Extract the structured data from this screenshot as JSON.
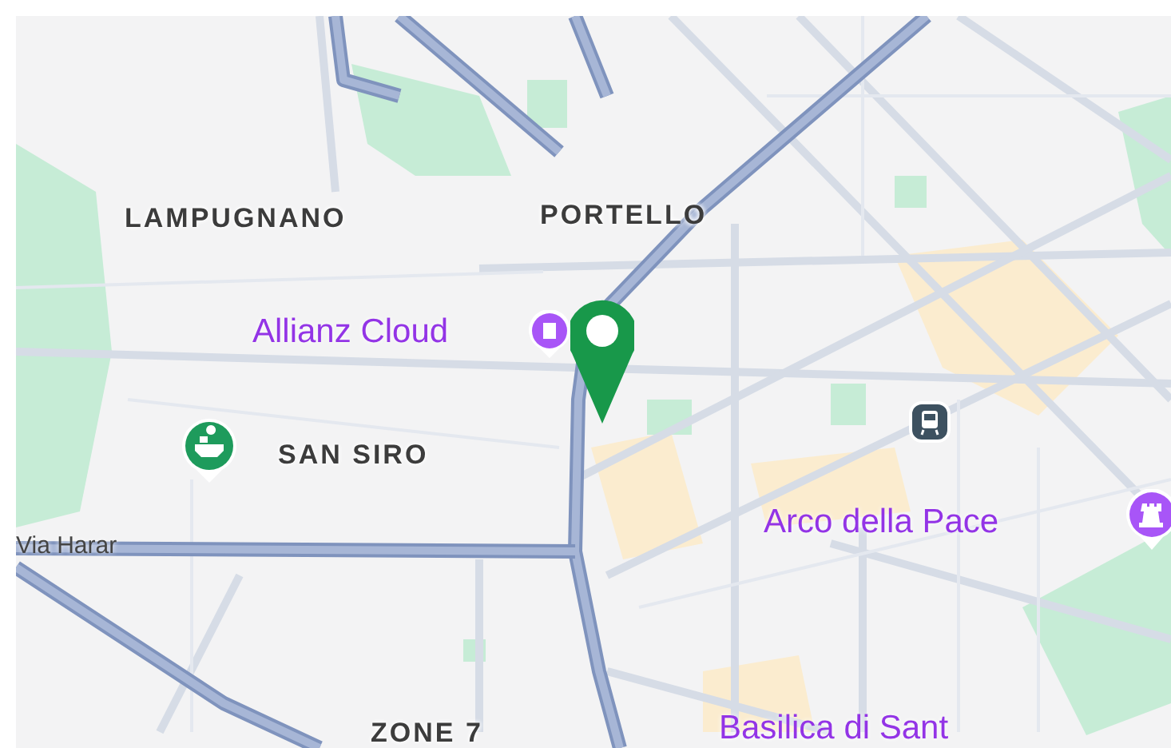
{
  "map": {
    "areas": [
      {
        "label": "LAMPUGNANO"
      },
      {
        "label": "PORTELLO"
      },
      {
        "label": "SAN SIRO"
      },
      {
        "label": "ZONE 7"
      }
    ],
    "places": [
      {
        "label": "Allianz Cloud",
        "kind": "arena"
      },
      {
        "label": "Arco della Pace",
        "kind": "monument"
      },
      {
        "label": "Basilica di Sant",
        "kind": "plain"
      }
    ],
    "streets": [
      {
        "label": "Via Harar"
      }
    ]
  }
}
